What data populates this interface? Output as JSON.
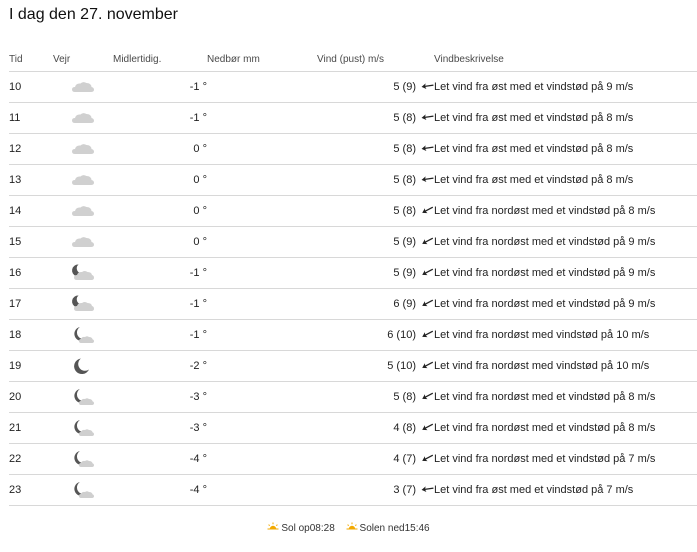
{
  "title": "I dag den 27. november",
  "columns": {
    "time": "Tid",
    "weather": "Vejr",
    "temp": "Midlertidig.",
    "precip": "Nedbør mm",
    "wind": "Vind (pust) m/s",
    "desc": "Vindbeskrivelse"
  },
  "rows": [
    {
      "time": "10",
      "icon": "cloud",
      "temp": "-1 °",
      "precip": "",
      "wind": "5 (9)",
      "wind_dir": "east",
      "desc": "Let vind fra øst med et vindstød på 9 m/s"
    },
    {
      "time": "11",
      "icon": "cloud",
      "temp": "-1 °",
      "precip": "",
      "wind": "5 (8)",
      "wind_dir": "east",
      "desc": "Let vind fra øst med et vindstød på 8 m/s"
    },
    {
      "time": "12",
      "icon": "cloud",
      "temp": "0 °",
      "precip": "",
      "wind": "5 (8)",
      "wind_dir": "east",
      "desc": "Let vind fra øst med et vindstød på 8 m/s"
    },
    {
      "time": "13",
      "icon": "cloud",
      "temp": "0 °",
      "precip": "",
      "wind": "5 (8)",
      "wind_dir": "east",
      "desc": "Let vind fra øst med et vindstød på 8 m/s"
    },
    {
      "time": "14",
      "icon": "cloud",
      "temp": "0 °",
      "precip": "",
      "wind": "5 (8)",
      "wind_dir": "northeast",
      "desc": "Let vind fra nordøst med et vindstød på 8 m/s"
    },
    {
      "time": "15",
      "icon": "cloud",
      "temp": "0 °",
      "precip": "",
      "wind": "5 (9)",
      "wind_dir": "northeast",
      "desc": "Let vind fra nordøst med et vindstød på 9 m/s"
    },
    {
      "time": "16",
      "icon": "moon-cloud",
      "temp": "-1 °",
      "precip": "",
      "wind": "5 (9)",
      "wind_dir": "northeast",
      "desc": "Let vind fra nordøst med et vindstød på 9 m/s"
    },
    {
      "time": "17",
      "icon": "moon-cloud",
      "temp": "-1 °",
      "precip": "",
      "wind": "6 (9)",
      "wind_dir": "northeast",
      "desc": "Let vind fra nordøst med et vindstød på 9 m/s"
    },
    {
      "time": "18",
      "icon": "moon-small-cloud",
      "temp": "-1 °",
      "precip": "",
      "wind": "6 (10)",
      "wind_dir": "northeast",
      "desc": "Let vind fra nordøst med vindstød på 10 m/s"
    },
    {
      "time": "19",
      "icon": "moon",
      "temp": "-2 °",
      "precip": "",
      "wind": "5 (10)",
      "wind_dir": "northeast",
      "desc": "Let vind fra nordøst med vindstød på 10 m/s"
    },
    {
      "time": "20",
      "icon": "moon-small-cloud",
      "temp": "-3 °",
      "precip": "",
      "wind": "5 (8)",
      "wind_dir": "northeast",
      "desc": "Let vind fra nordøst med et vindstød på 8 m/s"
    },
    {
      "time": "21",
      "icon": "moon-small-cloud",
      "temp": "-3 °",
      "precip": "",
      "wind": "4 (8)",
      "wind_dir": "northeast",
      "desc": "Let vind fra nordøst med et vindstød på 8 m/s"
    },
    {
      "time": "22",
      "icon": "moon-small-cloud",
      "temp": "-4 °",
      "precip": "",
      "wind": "4 (7)",
      "wind_dir": "northeast",
      "desc": "Let vind fra nordøst med et vindstød på 7 m/s"
    },
    {
      "time": "23",
      "icon": "moon-small-cloud",
      "temp": "-4 °",
      "precip": "",
      "wind": "3 (7)",
      "wind_dir": "east",
      "desc": "Let vind fra øst med et vindstød på 7 m/s"
    }
  ],
  "footer": {
    "sunrise_label": "Sol op",
    "sunrise_time": "08:28",
    "sunset_label": "Solen ned",
    "sunset_time": "15:46"
  },
  "colors": {
    "temp": "#1e6fc4",
    "sun": "#f2a900",
    "cloud": "#c9c9c9",
    "moon": "#555555"
  },
  "icons": {
    "cloud": "cloud-icon",
    "moon-cloud": "moon-cloud-icon",
    "moon-small-cloud": "moon-small-cloud-icon",
    "moon": "moon-icon",
    "wind_arrow": "wind-arrow-icon",
    "sun": "sun-icon"
  }
}
